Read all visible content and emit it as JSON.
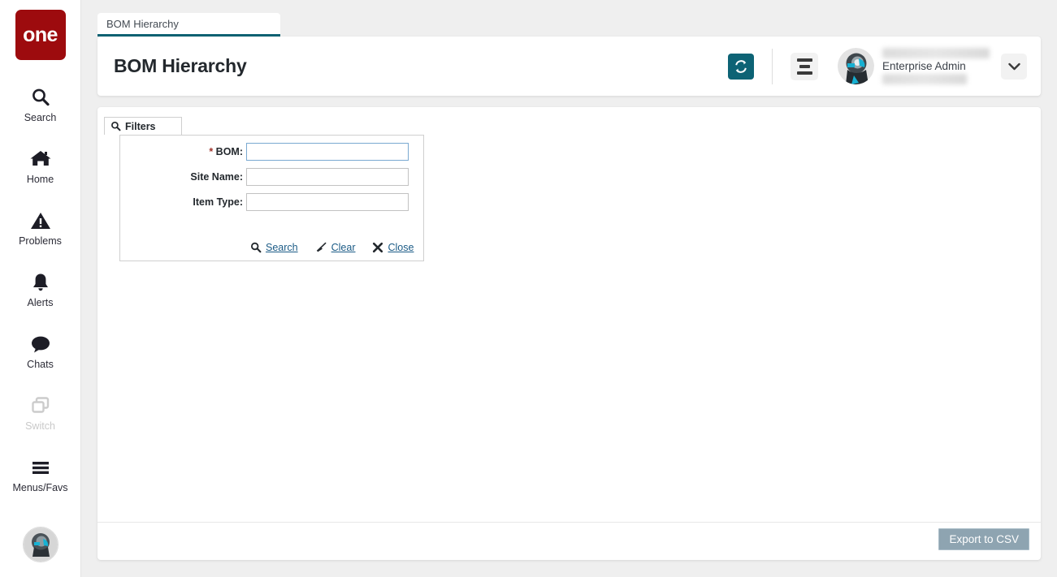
{
  "brand": {
    "logo_text": "one",
    "logo_color": "#9d0b0e"
  },
  "sidebar": {
    "items": [
      {
        "label": "Search",
        "icon": "search-icon",
        "disabled": false
      },
      {
        "label": "Home",
        "icon": "home-icon",
        "disabled": false
      },
      {
        "label": "Problems",
        "icon": "warning-icon",
        "disabled": false
      },
      {
        "label": "Alerts",
        "icon": "bell-icon",
        "disabled": false
      },
      {
        "label": "Chats",
        "icon": "chat-bubble-icon",
        "disabled": false
      },
      {
        "label": "Switch",
        "icon": "switch-icon",
        "disabled": true
      },
      {
        "label": "Menus/Favs",
        "icon": "hamburger-icon",
        "disabled": false
      }
    ],
    "avatar_icon": "user-avatar-image"
  },
  "tabs": [
    {
      "label": "BOM Hierarchy",
      "active": true
    }
  ],
  "header": {
    "title": "BOM Hierarchy",
    "refresh_icon": "refresh-icon",
    "refresh_color": "#0d6375",
    "menu_icon": "hamburger-icon",
    "avatar_icon": "user-avatar-image",
    "user_name_redacted": "",
    "user_role": "Enterprise Admin",
    "user_detail_redacted": "",
    "dropdown_icon": "chevron-down-icon"
  },
  "filters": {
    "tab_label": "Filters",
    "tab_icon": "search-icon",
    "fields": [
      {
        "label": "BOM:",
        "required": true,
        "value": "",
        "placeholder": "",
        "focused": true
      },
      {
        "label": "Site Name:",
        "required": false,
        "value": "",
        "placeholder": "",
        "focused": false
      },
      {
        "label": "Item Type:",
        "required": false,
        "value": "",
        "placeholder": "",
        "focused": false
      }
    ],
    "actions": [
      {
        "label": "Search",
        "icon": "search-icon"
      },
      {
        "label": "Clear",
        "icon": "broom-icon"
      },
      {
        "label": "Close",
        "icon": "close-x-icon"
      }
    ]
  },
  "footer": {
    "export_label": "Export to CSV",
    "export_color": "#8ea4b1"
  }
}
